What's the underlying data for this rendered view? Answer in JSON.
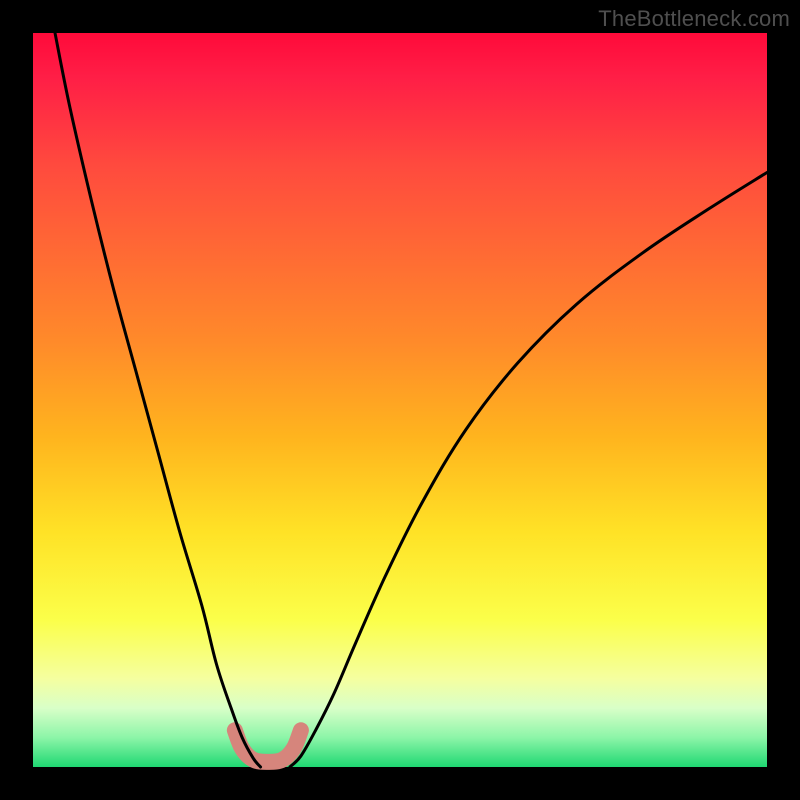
{
  "watermark": "TheBottleneck.com",
  "chart_data": {
    "type": "line",
    "title": "",
    "xlabel": "",
    "ylabel": "",
    "xlim": [
      0,
      100
    ],
    "ylim": [
      0,
      100
    ],
    "series": [
      {
        "name": "left-curve",
        "x": [
          3,
          5,
          8,
          11,
          14,
          17,
          20,
          23,
          25,
          27,
          28.5,
          30,
          31
        ],
        "y": [
          100,
          90,
          77,
          65,
          54,
          43,
          32,
          22,
          14,
          8,
          4,
          1.2,
          0
        ]
      },
      {
        "name": "right-curve",
        "x": [
          35,
          36.5,
          38.5,
          41,
          44,
          48,
          53,
          59,
          66,
          74,
          83,
          92,
          100
        ],
        "y": [
          0,
          1.5,
          5,
          10,
          17,
          26,
          36,
          46,
          55,
          63,
          70,
          76,
          81
        ]
      },
      {
        "name": "floor-band",
        "x": [
          27.5,
          28.5,
          30,
          32,
          34,
          35.5,
          36.5
        ],
        "y": [
          5,
          2.5,
          1,
          0.7,
          1,
          2.5,
          5
        ]
      }
    ],
    "gradient_stops": [
      {
        "pos": 0.0,
        "color": "#ff0a3a"
      },
      {
        "pos": 0.06,
        "color": "#ff1e46"
      },
      {
        "pos": 0.18,
        "color": "#ff4a3e"
      },
      {
        "pos": 0.3,
        "color": "#ff6a34"
      },
      {
        "pos": 0.42,
        "color": "#ff8a2a"
      },
      {
        "pos": 0.55,
        "color": "#ffb41e"
      },
      {
        "pos": 0.68,
        "color": "#ffe226"
      },
      {
        "pos": 0.8,
        "color": "#fbff4a"
      },
      {
        "pos": 0.88,
        "color": "#f5ffa0"
      },
      {
        "pos": 0.92,
        "color": "#d8ffc8"
      },
      {
        "pos": 0.96,
        "color": "#8cf5a8"
      },
      {
        "pos": 1.0,
        "color": "#1fd872"
      }
    ],
    "frame": {
      "outer": 800,
      "margin": 33
    },
    "curve_color": "#000000",
    "floor_color": "#d6857c"
  }
}
